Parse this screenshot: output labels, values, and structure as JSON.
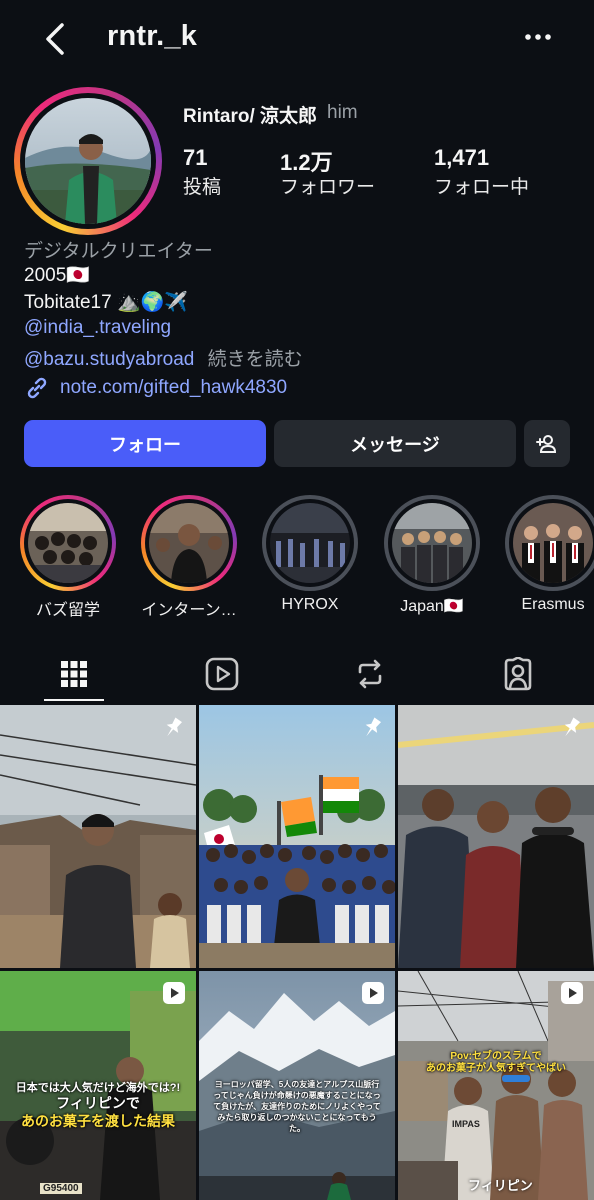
{
  "header": {
    "username": "rntr._k",
    "back_icon": "chevron-left-icon",
    "more_icon": "more-dots-icon"
  },
  "profile": {
    "display_name": "Rintaro/ 涼太郎",
    "pronoun": "him",
    "stats": [
      {
        "value": "71",
        "label": "投稿"
      },
      {
        "value": "1.2万",
        "label": "フォロワー"
      },
      {
        "value": "1,471",
        "label": "フォロー中"
      }
    ]
  },
  "bio": {
    "category": "デジタルクリエイター",
    "line1": "2005🇯🇵",
    "line2": "Tobitate17 ⛰️🌍✈️",
    "mention1": "@india_.traveling",
    "mention2": "@bazu.studyabroad",
    "more": "続きを読む",
    "link": "note.com/gifted_hawk4830"
  },
  "actions": {
    "follow": "フォロー",
    "message": "メッセージ",
    "add_icon": "add-person-icon"
  },
  "highlights": [
    {
      "label": "バズ留学",
      "ring": "gradient"
    },
    {
      "label": "インターン…",
      "ring": "gradient"
    },
    {
      "label": "HYROX",
      "ring": "gray"
    },
    {
      "label": "Japan🇯🇵",
      "ring": "gray"
    },
    {
      "label": "Erasmus",
      "ring": "gray"
    }
  ],
  "tabs": [
    "grid-icon",
    "reels-icon",
    "reposts-icon",
    "tagged-icon"
  ],
  "posts": {
    "p4_line1": "日本では大人気だけど海外では?!",
    "p4_line2": "フィリピンで",
    "p4_line3": "あのお菓子を渡した結果",
    "p4_plate": "G95400",
    "p5_text": "ヨーロッパ留学、5人の友達とアルプス山脈行ってじゃん負けが命懸けの悪魔することになって負けたが、友達作りのためにノリよくやってみたら取り返しのつかないことになってもうた。",
    "p6_line1": "Pov:セブのスラムで",
    "p6_line2": "あのお菓子が人気すぎてやばい",
    "p6_label": "フィリピン",
    "p6_shirt": "IMPAS"
  },
  "colors": {
    "background": "#0c0f14",
    "follow_button": "#4a5df9",
    "link": "#8fa7ff"
  }
}
